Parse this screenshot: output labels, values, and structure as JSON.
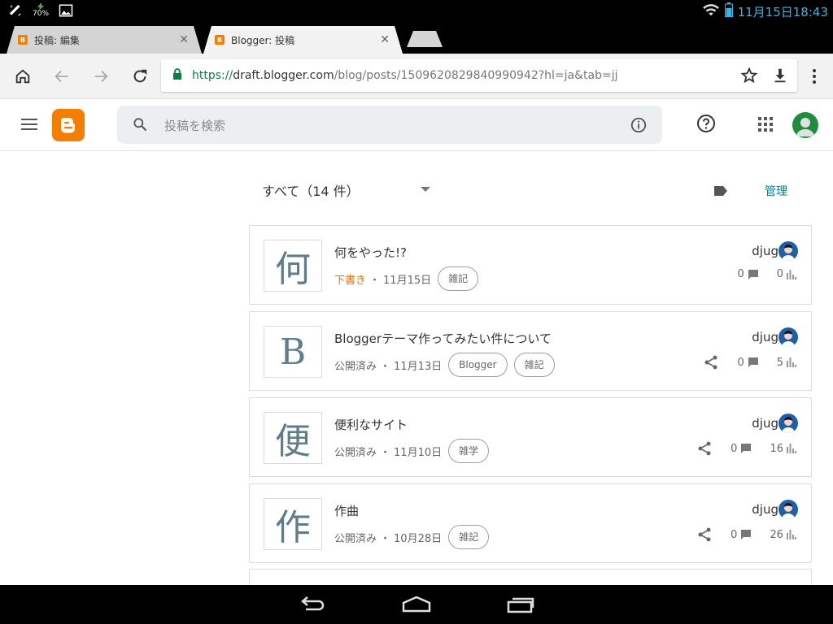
{
  "status_bar": {
    "battery_percent": "70%",
    "time": "11月15日18:43"
  },
  "tabs": [
    {
      "title": "投稿: 編集",
      "close": "✕"
    },
    {
      "title": "Blogger: 投稿",
      "close": "✕"
    }
  ],
  "address_bar": {
    "scheme": "https://",
    "host": "draft.blogger.com",
    "path": "/blog/posts/1509620829840990942?hl=ja&tab=jj"
  },
  "blogger": {
    "search_placeholder": "投稿を検索",
    "filter_label": "すべて（14 件）",
    "manage_label": "管理"
  },
  "posts": [
    {
      "thumb": "何",
      "title": "何をやった!?",
      "status": "下書き",
      "date": "11月15日",
      "labels": [
        "雑記"
      ],
      "author": "djug",
      "comments": "0",
      "views": "0",
      "share": false
    },
    {
      "thumb": "B",
      "title": "Bloggerテーマ作ってみたい件について",
      "status": "公開済み",
      "date": "11月13日",
      "labels": [
        "Blogger",
        "雑記"
      ],
      "author": "djug",
      "comments": "0",
      "views": "5",
      "share": true
    },
    {
      "thumb": "便",
      "title": "便利なサイト",
      "status": "公開済み",
      "date": "11月10日",
      "labels": [
        "雑学"
      ],
      "author": "djug",
      "comments": "0",
      "views": "16",
      "share": true
    },
    {
      "thumb": "作",
      "title": "作曲",
      "status": "公開済み",
      "date": "10月28日",
      "labels": [
        "雑記"
      ],
      "author": "djug",
      "comments": "0",
      "views": "26",
      "share": true
    }
  ],
  "colors": {
    "blogger_orange": "#f57d00",
    "draft_orange": "#e8710a",
    "link_teal": "#00838f",
    "status_blue": "#33b5e5"
  }
}
